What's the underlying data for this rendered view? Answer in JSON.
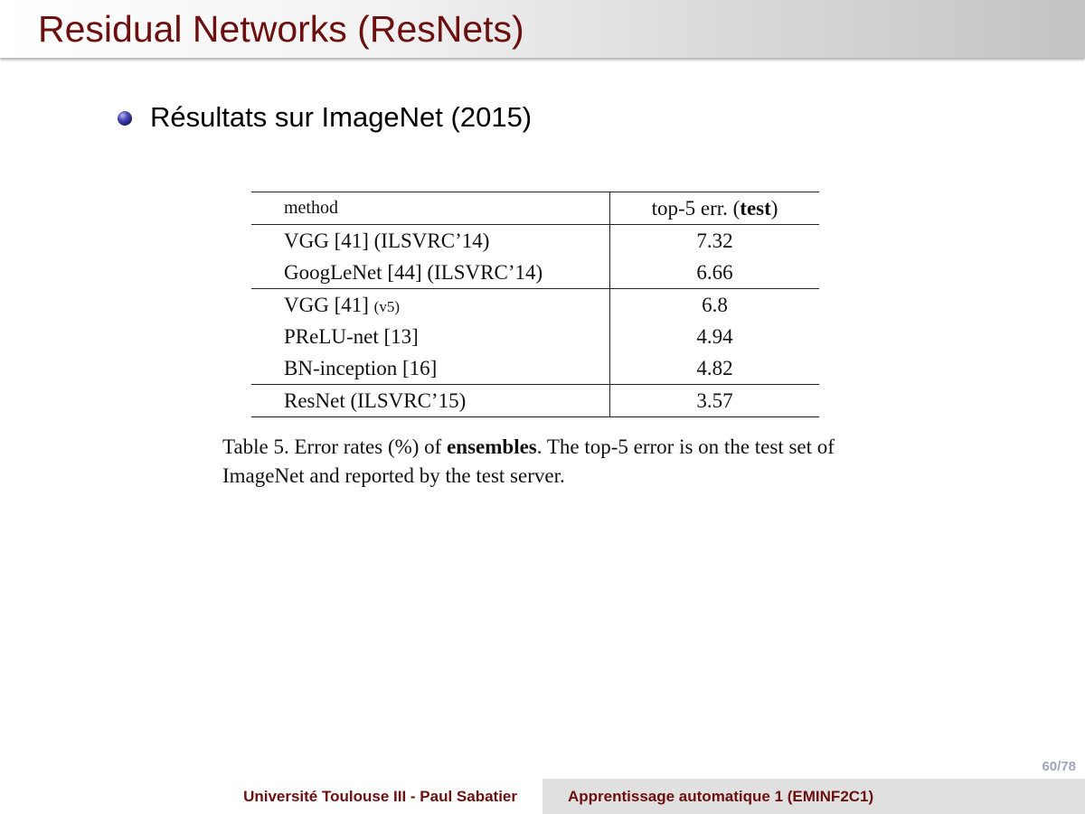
{
  "slide": {
    "title": "Residual Networks (ResNets)",
    "bullet": "Résultats sur ImageNet (2015)",
    "page_number": "60/78"
  },
  "table": {
    "headers": {
      "method": "method",
      "err_prefix": "top-5 err. (",
      "err_bold": "test",
      "err_suffix": ")"
    },
    "rows": [
      {
        "method": "VGG [41] (ILSVRC’14)",
        "method_suffix": "",
        "err": "7.32"
      },
      {
        "method": "GoogLeNet [44] (ILSVRC’14)",
        "method_suffix": "",
        "err": "6.66"
      },
      {
        "method": "VGG [41] ",
        "method_suffix": "(v5)",
        "err": "6.8"
      },
      {
        "method": "PReLU-net [13]",
        "method_suffix": "",
        "err": "4.94"
      },
      {
        "method": "BN-inception [16]",
        "method_suffix": "",
        "err": "4.82"
      },
      {
        "method": "ResNet (ILSVRC’15)",
        "method_suffix": "",
        "err": "3.57"
      }
    ]
  },
  "caption": {
    "prefix": "Table 5. Error rates (%) of ",
    "bold": "ensembles",
    "suffix": ".  The top-5 error is on the test set of ImageNet and reported by the test server."
  },
  "footer": {
    "left": "Université Toulouse III - Paul Sabatier",
    "right": "Apprentissage automatique 1 (EMINF2C1)"
  }
}
